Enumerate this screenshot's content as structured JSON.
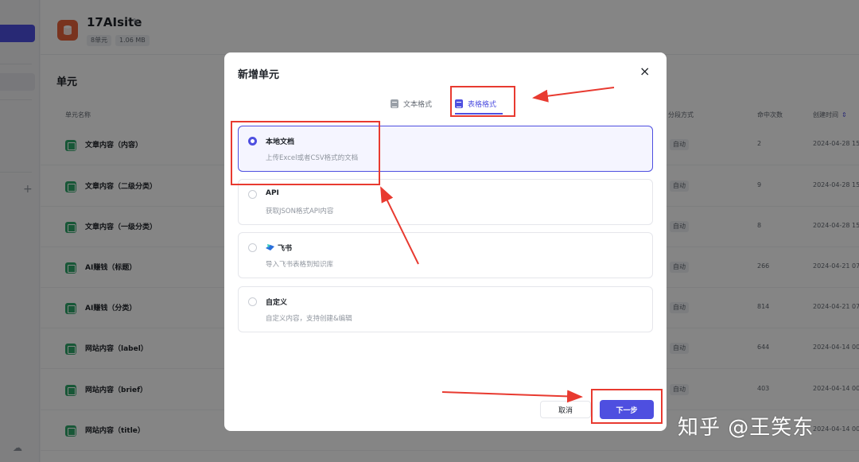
{
  "kb": {
    "title": "17AIsite",
    "units_tag": "8单元",
    "size_tag": "1.06 MB"
  },
  "section_title": "单元",
  "columns": {
    "name": "单元名称",
    "split": "分段方式",
    "hits": "命中次数",
    "created": "创建时间"
  },
  "rows": [
    {
      "name": "文章内容（内容）",
      "split": "自动",
      "hits": "2",
      "created": "2024-04-28 15:"
    },
    {
      "name": "文章内容（二级分类）",
      "split": "自动",
      "hits": "9",
      "created": "2024-04-28 15:"
    },
    {
      "name": "文章内容（一级分类）",
      "split": "自动",
      "hits": "8",
      "created": "2024-04-28 15:"
    },
    {
      "name": "AI赚钱（标题）",
      "split": "自动",
      "hits": "266",
      "created": "2024-04-21 07:"
    },
    {
      "name": "AI赚钱（分类）",
      "split": "自动",
      "hits": "814",
      "created": "2024-04-21 07:"
    },
    {
      "name": "网站内容（label）",
      "split": "自动",
      "hits": "644",
      "created": "2024-04-14 00:"
    },
    {
      "name": "网站内容（brief）",
      "split": "自动",
      "hits": "403",
      "created": "2024-04-14 00:"
    },
    {
      "name": "网站内容（title）",
      "split": "",
      "hits": "",
      "created": "2024-04-14 00:"
    }
  ],
  "modal": {
    "title": "新增单元",
    "close": "×",
    "tabs": [
      {
        "label": "文本格式"
      },
      {
        "label": "表格格式",
        "active": true
      }
    ],
    "options": [
      {
        "title": "本地文档",
        "desc": "上传Excel或者CSV格式的文档",
        "selected": true
      },
      {
        "title": "API",
        "desc": "获取JSON格式API内容"
      },
      {
        "title": "飞书",
        "desc": "导入飞书表格到知识库"
      },
      {
        "title": "自定义",
        "desc": "自定义内容，支持创建&编辑"
      }
    ],
    "cancel": "取消",
    "next": "下一步"
  },
  "watermark": "知乎 @王笑东",
  "colors": {
    "accent": "#4e4fe0",
    "annotation_red": "#e83a30",
    "row_icon_green": "#2fa86a"
  }
}
